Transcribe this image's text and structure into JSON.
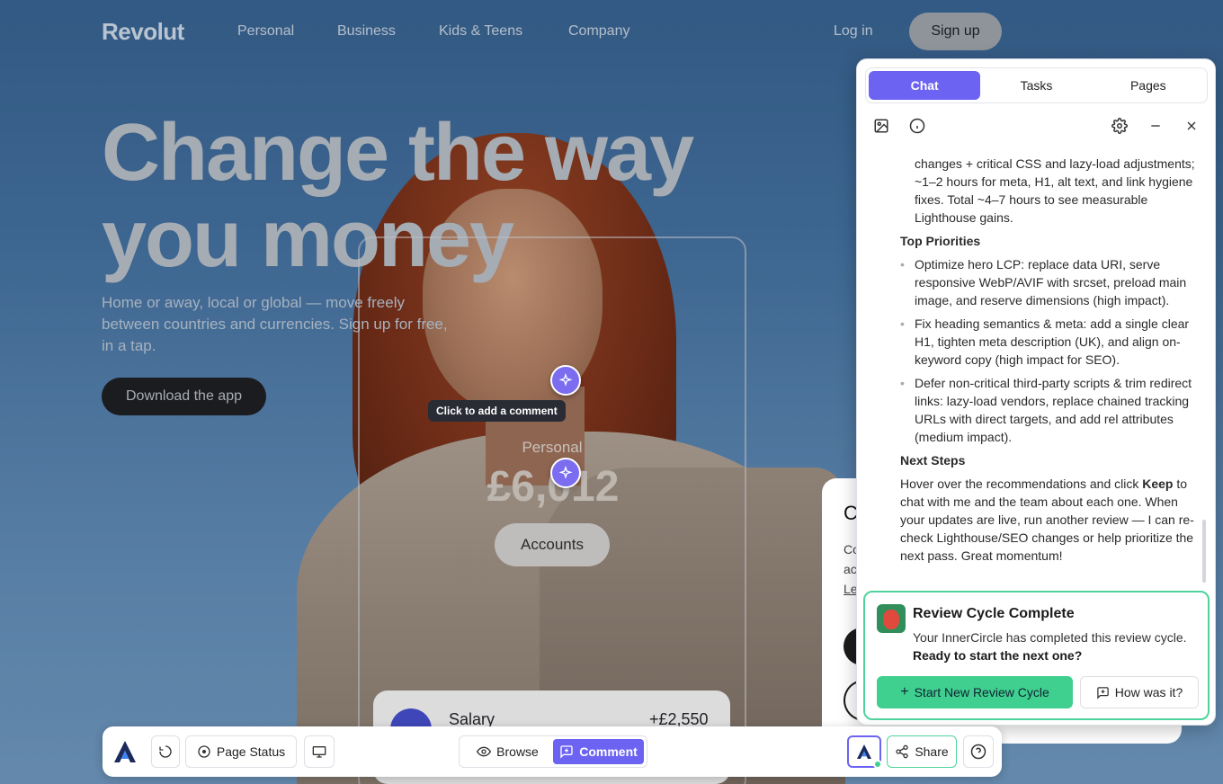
{
  "nav": {
    "logo": "Revolut",
    "links": [
      "Personal",
      "Business",
      "Kids & Teens",
      "Company"
    ],
    "login": "Log in",
    "signup": "Sign up"
  },
  "hero": {
    "title": "Change the way you money",
    "subtitle": "Home or away, local or global — move freely between countries and currencies. Sign up for free, in a tap.",
    "download": "Download the app"
  },
  "phone": {
    "account_label": "Personal",
    "balance": "£6,012",
    "accounts_button": "Accounts",
    "transaction_label": "Salary",
    "transaction_value": "+£2,550"
  },
  "comment_tooltip": "Click to add a comment",
  "cookie": {
    "title": "C",
    "line1": "Co",
    "line2": "ac",
    "link": "Le"
  },
  "panel": {
    "tabs": [
      "Chat",
      "Tasks",
      "Pages"
    ],
    "active_tab": "Chat",
    "chat": {
      "intro_cont": "changes + critical CSS and lazy-load adjustments; ~1–2 hours for meta, H1, alt text, and link hygiene fixes. Total ~4–7 hours to see measurable Lighthouse gains.",
      "top_priorities_heading": "Top Priorities",
      "priorities": [
        "Optimize hero LCP: replace data URI, serve responsive WebP/AVIF with srcset, preload main image, and reserve dimensions (high impact).",
        "Fix heading semantics & meta: add a single clear H1, tighten meta description (UK), and align on-keyword copy (high impact for SEO).",
        "Defer non-critical third-party scripts & trim redirect links: lazy-load vendors, replace chained tracking URLs with direct targets, and add rel attributes (medium impact)."
      ],
      "next_steps_heading": "Next Steps",
      "next_steps_pre": "Hover over the recommendations and click ",
      "next_steps_keep": "Keep",
      "next_steps_post": " to chat with me and the team about each one. When your updates are live, run another review — I can re-check Lighthouse/SEO changes or help prioritize the next pass. Great momentum!"
    },
    "review": {
      "title": "Review Cycle Complete",
      "text": "Your InnerCircle has completed this review cycle.",
      "text_bold": "Ready to start the next one?",
      "start_button": "Start New Review Cycle",
      "feedback_button": "How was it?"
    }
  },
  "toolbar": {
    "page_status": "Page Status",
    "browse": "Browse",
    "comment": "Comment",
    "share": "Share"
  },
  "colors": {
    "accent": "#6c63f2",
    "success": "#3fcf8e"
  }
}
